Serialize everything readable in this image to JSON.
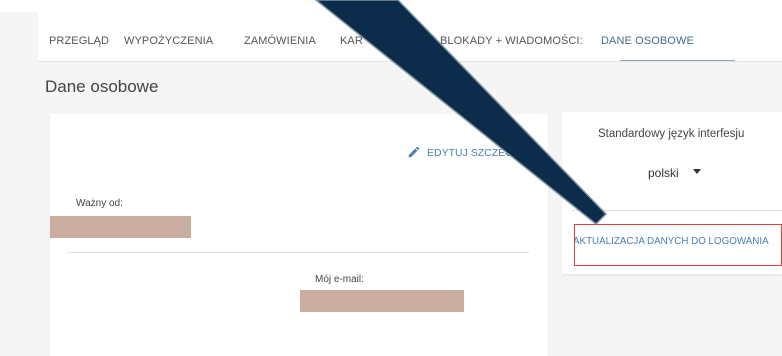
{
  "tabs": [
    {
      "label": "PRZEGLĄD",
      "active": false
    },
    {
      "label": "WYPOŻYCZENIA",
      "active": false
    },
    {
      "label": "ZAMÓWIENIA",
      "active": false
    },
    {
      "label": "KAR",
      "active": false
    },
    {
      "label": "BLOKADY + WIADOMOŚCI:",
      "active": false
    },
    {
      "label": "DANE OSOBOWE",
      "active": true
    }
  ],
  "page_title": "Dane osobowe",
  "personal_card": {
    "edit_label": "EDYTUJ SZCZEGÓ",
    "valid_from_label": "Ważny od:",
    "email_label": "Mój e-mail:"
  },
  "settings_card": {
    "language_label": "Standardowy język interfesju",
    "language_value": "polski",
    "update_login_label": "AKTUALIZACJA DANYCH DO LOGOWANIA"
  },
  "colors": {
    "accent": "#4a7fb5",
    "redaction": "#c8ada0",
    "highlight_border": "#e04040",
    "annotation_arrow": "#0d2b4a"
  },
  "icons": {
    "edit": "pencil-icon",
    "dropdown": "caret-down-icon"
  }
}
